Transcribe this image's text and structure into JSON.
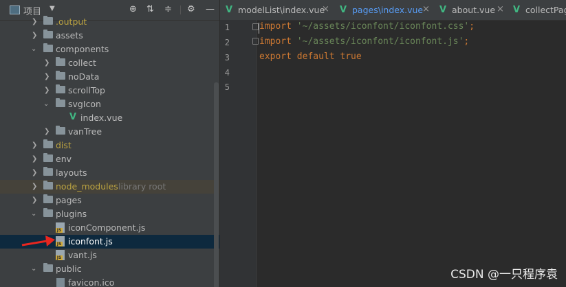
{
  "project_panel": {
    "title": "项目",
    "dropdown_icon": "chevron-down-icon",
    "toolbar_icons": [
      "locate-icon",
      "expand-all-icon",
      "collapse-all-icon",
      "gear-icon",
      "minimize-icon"
    ]
  },
  "tree": {
    "items": [
      {
        "label": ".output",
        "type": "folder",
        "excluded": true
      },
      {
        "label": "assets",
        "type": "folder"
      },
      {
        "label": "components",
        "type": "folder",
        "expanded": true
      },
      {
        "label": "collect",
        "type": "folder"
      },
      {
        "label": "noData",
        "type": "folder"
      },
      {
        "label": "scrollTop",
        "type": "folder"
      },
      {
        "label": "svgIcon",
        "type": "folder",
        "expanded": true
      },
      {
        "label": "index.vue",
        "type": "vue-file"
      },
      {
        "label": "vanTree",
        "type": "folder"
      },
      {
        "label": "dist",
        "type": "folder",
        "excluded": true
      },
      {
        "label": "env",
        "type": "folder"
      },
      {
        "label": "layouts",
        "type": "folder"
      },
      {
        "label": "node_modules",
        "type": "folder",
        "library": true,
        "suffix": "library root"
      },
      {
        "label": "pages",
        "type": "folder"
      },
      {
        "label": "plugins",
        "type": "folder",
        "expanded": true
      },
      {
        "label": "iconComponent.js",
        "type": "js-file"
      },
      {
        "label": "iconfont.js",
        "type": "js-file",
        "selected": true
      },
      {
        "label": "vant.js",
        "type": "js-file"
      },
      {
        "label": "public",
        "type": "folder",
        "expanded": true
      },
      {
        "label": "favicon.ico",
        "type": "ico-file"
      }
    ]
  },
  "tabs": [
    {
      "label": "modelList\\index.vue",
      "close": "×"
    },
    {
      "label": "pages\\index.vue",
      "close": "×",
      "active": true
    },
    {
      "label": "about.vue",
      "close": "×"
    },
    {
      "label": "collectPag"
    }
  ],
  "editor": {
    "line_numbers": [
      "1",
      "2",
      "3",
      "4",
      "5"
    ],
    "lines": [
      {
        "kw": "import",
        "str": " '~/assets/iconfont/iconfont.css'",
        "end": ";"
      },
      {
        "kw": "import",
        "str": " '~/assets/iconfont/iconfont.js'",
        "end": ";"
      },
      {
        "kw": "export default true",
        "str": "",
        "end": ""
      }
    ]
  },
  "watermark": "CSDN @一只程序袁",
  "colors": {
    "accent_vue": "#41b883",
    "keyword": "#cc7832",
    "string": "#6a8759",
    "selection": "#0d293e",
    "annotation_arrow": "#e8261f"
  }
}
